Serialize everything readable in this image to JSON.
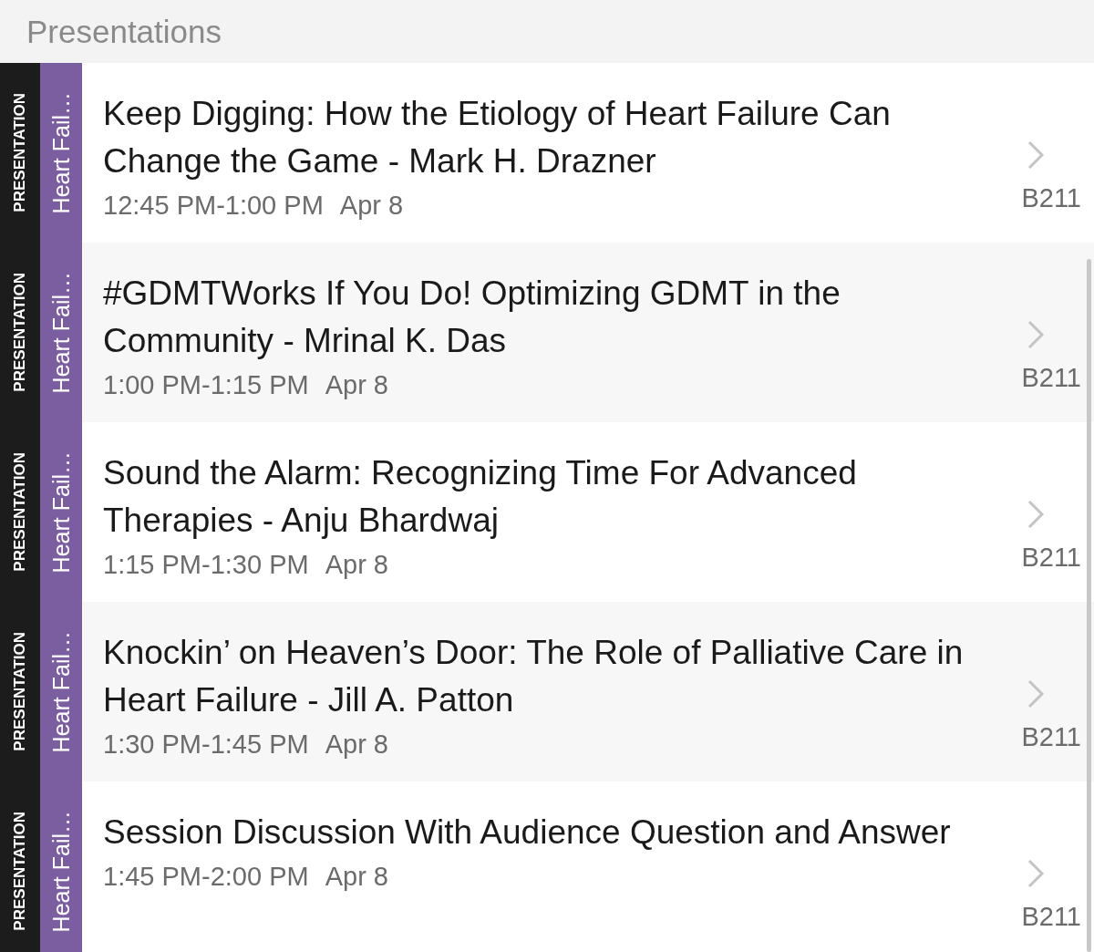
{
  "header": {
    "title": "Presentations"
  },
  "items": [
    {
      "type_label": "PRESENTATION",
      "track": "Heart Fail…",
      "title": "Keep Digging: How the Etiology of Heart Failure Can Change the Game - Mark H. Drazner",
      "time": "12:45 PM-1:00 PM",
      "date": "Apr 8",
      "room": "B211"
    },
    {
      "type_label": "PRESENTATION",
      "track": "Heart Fail…",
      "title": "#GDMTWorks If You Do! Optimizing GDMT in the Community - Mrinal K. Das",
      "time": "1:00 PM-1:15 PM",
      "date": "Apr 8",
      "room": "B211"
    },
    {
      "type_label": "PRESENTATION",
      "track": "Heart Fail…",
      "title": "Sound the Alarm: Recognizing Time For Advanced Therapies - Anju Bhardwaj",
      "time": "1:15 PM-1:30 PM",
      "date": "Apr 8",
      "room": "B211"
    },
    {
      "type_label": "PRESENTATION",
      "track": "Heart Fail…",
      "title": "Knockin’ on Heaven’s Door: The Role of Palliative Care in Heart Failure - Jill A. Patton",
      "time": "1:30 PM-1:45 PM",
      "date": "Apr 8",
      "room": "B211"
    },
    {
      "type_label": "PRESENTATION",
      "track": "Heart Fail…",
      "title": "Session Discussion With Audience Question and Answer",
      "time": "1:45 PM-2:00 PM",
      "date": "Apr 8",
      "room": "B211"
    }
  ]
}
